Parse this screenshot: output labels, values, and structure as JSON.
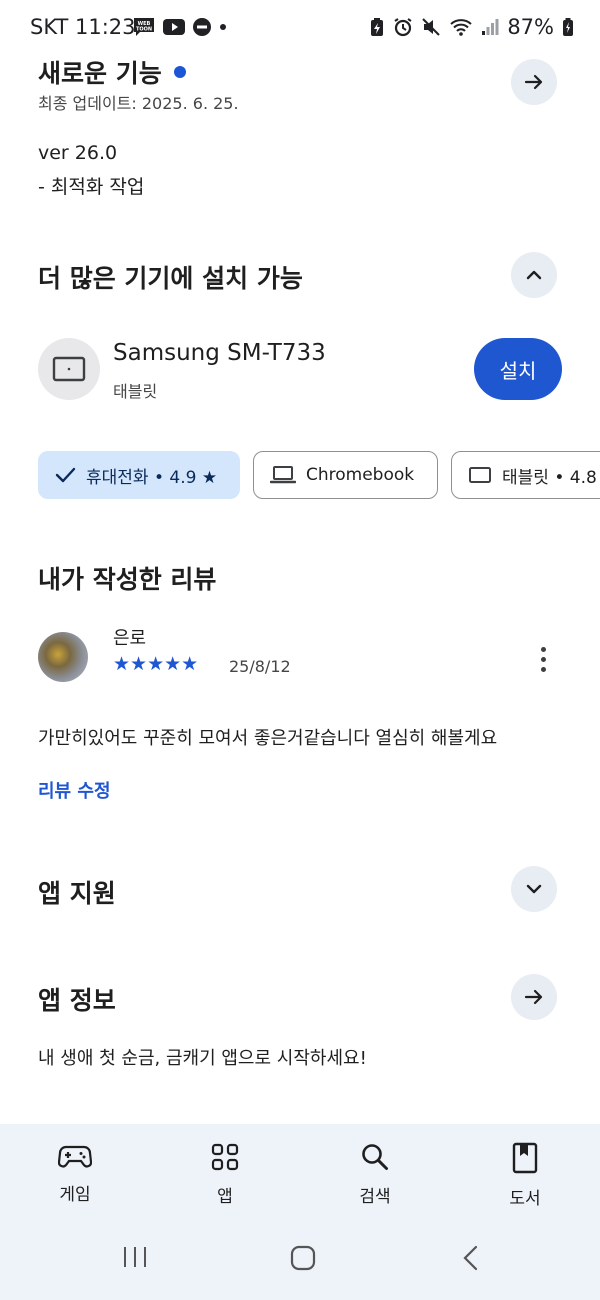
{
  "status_bar": {
    "time": "SKT 11:23",
    "left_icons": [
      "webtoon-icon",
      "youtube-icon",
      "do-not-disturb-icon",
      "dot-icon"
    ],
    "right_icons": [
      "battery-saver-icon",
      "alarm-icon",
      "mute-icon",
      "wifi-icon",
      "signal-icon"
    ],
    "battery": "87%"
  },
  "whats_new": {
    "title": "새로운 기능",
    "updated": "최종 업데이트: 2025. 6. 25.",
    "version": "ver 26.0",
    "note": "- 최적화 작업"
  },
  "more_devices": {
    "title": "더 많은 기기에 설치 가능",
    "device_name": "Samsung SM-T733",
    "device_type": "태블릿",
    "install_label": "설치",
    "chips": [
      {
        "label": "휴대전화 • 4.9 ★",
        "icon": "check-icon",
        "selected": true
      },
      {
        "label": "Chromebook",
        "icon": "laptop-icon",
        "selected": false
      },
      {
        "label": "태블릿 • 4.8 ★",
        "icon": "tablet-icon",
        "selected": false
      }
    ]
  },
  "my_review": {
    "title": "내가 작성한 리뷰",
    "author": "은로",
    "rating": 5,
    "stars": "★★★★★",
    "date": "25/8/12",
    "text": "가만히있어도 꾸준히 모여서 좋은거같습니다 열심히 해볼게요",
    "edit_label": "리뷰 수정"
  },
  "app_support": {
    "title": "앱 지원"
  },
  "app_info": {
    "title": "앱 정보",
    "description": "내 생애 첫 순금, 금캐기 앱으로 시작하세요!"
  },
  "bottom_nav": [
    {
      "label": "게임",
      "icon": "gamepad-icon"
    },
    {
      "label": "앱",
      "icon": "apps-grid-icon"
    },
    {
      "label": "검색",
      "icon": "search-icon"
    },
    {
      "label": "도서",
      "icon": "book-icon"
    }
  ],
  "colors": {
    "accent": "#1f57d1",
    "chip_selected": "#d3e6fb",
    "nav_bg": "#eef2f9",
    "button_bg": "#e8ecf3"
  }
}
